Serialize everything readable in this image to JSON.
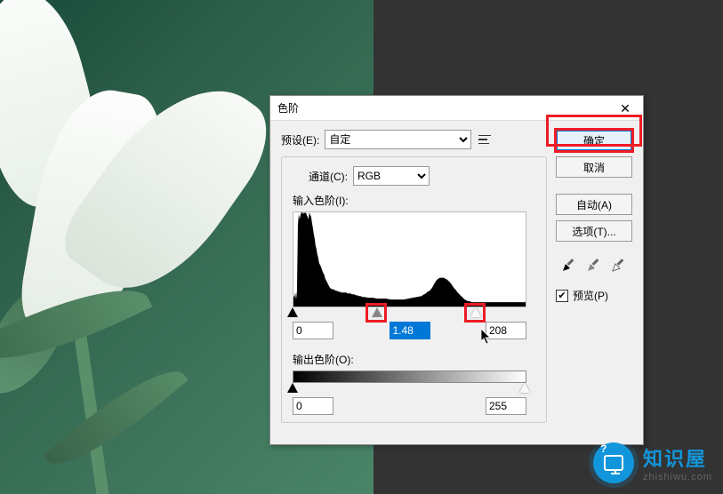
{
  "dialog": {
    "title": "色阶",
    "preset_label": "预设(E):",
    "preset_value": "自定",
    "channel_label": "通道(C):",
    "channel_value": "RGB",
    "input_levels_label": "输入色阶(I):",
    "output_levels_label": "输出色阶(O):"
  },
  "input_levels": {
    "black": "0",
    "mid": "1.48",
    "white": "208"
  },
  "output_levels": {
    "black": "0",
    "white": "255"
  },
  "buttons": {
    "ok": "确定",
    "cancel": "取消",
    "auto": "自动(A)",
    "options": "选项(T)..."
  },
  "preview": {
    "checked": true,
    "label": "预览(P)"
  },
  "watermark": {
    "name": "知识屋",
    "url": "zhishiwu.com"
  }
}
